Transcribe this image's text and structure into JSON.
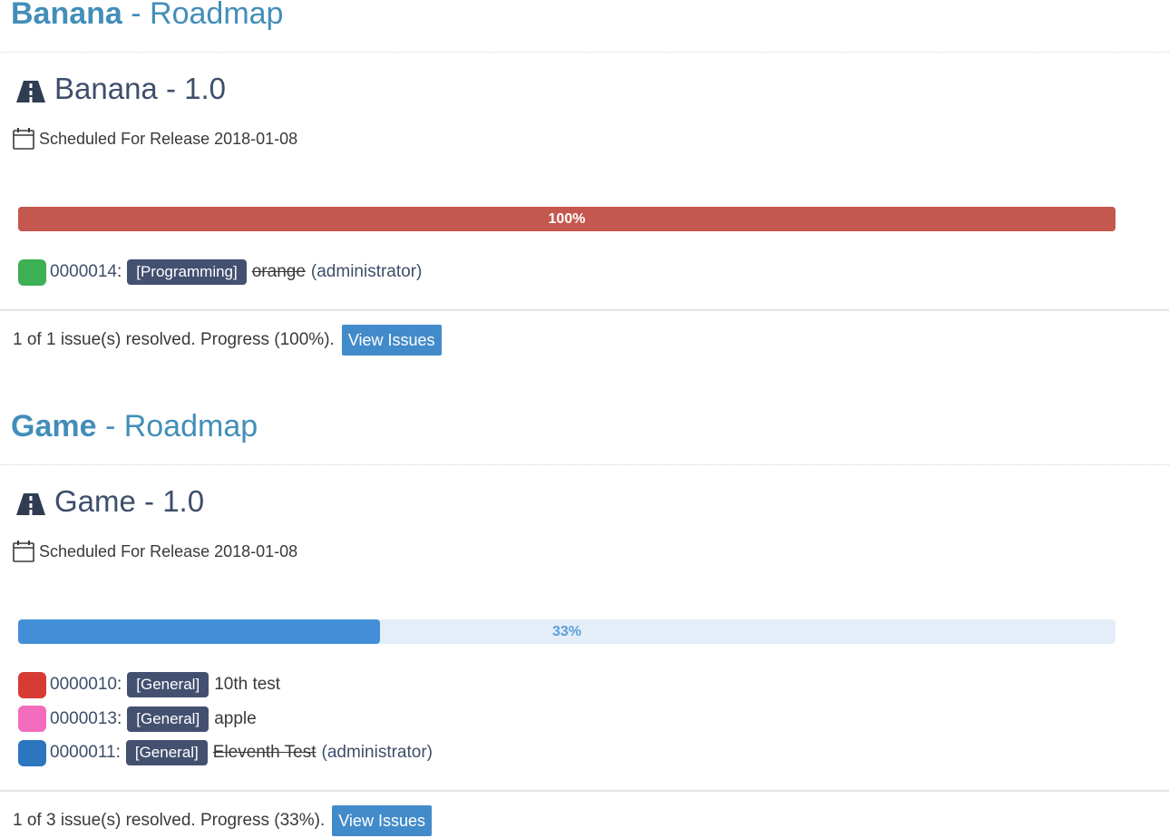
{
  "projects": [
    {
      "name": "Banana",
      "title_suffix": " - Roadmap",
      "version_title": "Banana - 1.0",
      "release_text": "Scheduled For Release 2018-01-08",
      "progress": {
        "percent": 100,
        "label": "100%",
        "fill_color": "#c4574e",
        "track_color": "#c4574e",
        "label_color": "#ffffff"
      },
      "issues": [
        {
          "status_color": "#3eb054",
          "id": "0000014",
          "category": "[Programming]",
          "summary": "orange",
          "resolved": true,
          "handler": "(administrator)"
        }
      ],
      "summary": "1 of 1 issue(s) resolved. Progress (100%).",
      "view_button": "View Issues"
    },
    {
      "name": "Game",
      "title_suffix": " - Roadmap",
      "version_title": "Game - 1.0",
      "release_text": "Scheduled For Release 2018-01-08",
      "progress": {
        "percent": 33,
        "label": "33%",
        "fill_color": "#428fd7",
        "track_color": "#e3eef8",
        "label_color": "#5a9fd8"
      },
      "issues": [
        {
          "status_color": "#d63c33",
          "id": "0000010",
          "category": "[General]",
          "summary": "10th test",
          "resolved": false,
          "handler": ""
        },
        {
          "status_color": "#f46cbd",
          "id": "0000013",
          "category": "[General]",
          "summary": "apple",
          "resolved": false,
          "handler": ""
        },
        {
          "status_color": "#2c75bf",
          "id": "0000011",
          "category": "[General]",
          "summary": "Eleventh Test",
          "resolved": true,
          "handler": "(administrator)"
        }
      ],
      "summary": "1 of 3 issue(s) resolved. Progress (33%).",
      "view_button": "View Issues"
    }
  ]
}
